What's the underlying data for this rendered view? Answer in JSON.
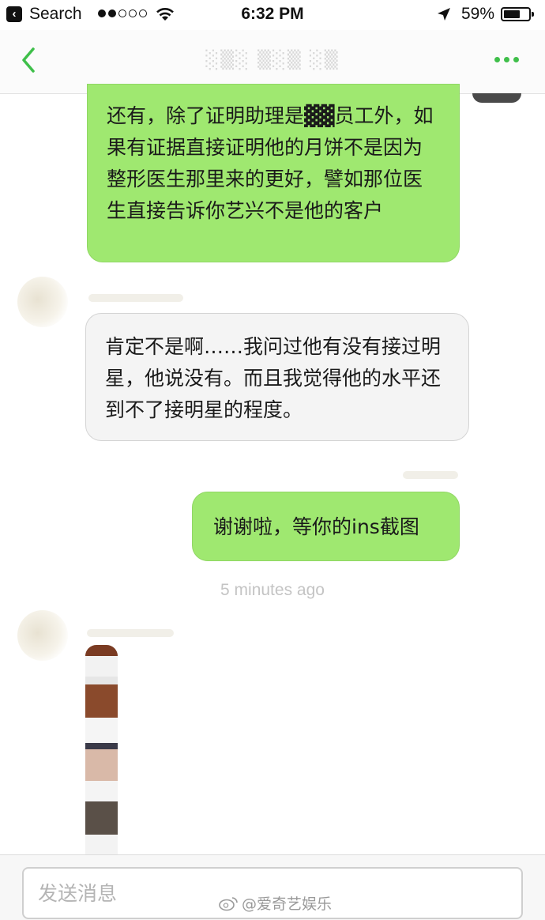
{
  "status_bar": {
    "back_app_label": "Search",
    "signal_bars": [
      true,
      true,
      false,
      false,
      false
    ],
    "time": "6:32 PM",
    "battery_text": "59%",
    "battery_level": 0.59
  },
  "nav": {
    "back_icon": "chevron-left-icon",
    "more_icon": "ellipsis-icon",
    "accent_color": "#3fbf4a"
  },
  "messages": [
    {
      "direction": "outgoing",
      "text": "还有，除了证明助理是▓▓员工外，如果有证据直接证明他的月饼不是因为整形医生那里来的更好，譬如那位医生直接告诉你艺兴不是他的客户"
    },
    {
      "direction": "incoming",
      "text": "肯定不是啊……我问过他有没有接过明星，他说没有。而且我觉得他的水平还到不了接明星的程度。"
    },
    {
      "direction": "outgoing",
      "text": "谢谢啦，等你的ins截图"
    }
  ],
  "timestamp": "5 minutes ago",
  "composer": {
    "placeholder": "发送消息"
  },
  "watermark": "@爱奇艺娱乐",
  "colors": {
    "outgoing_bubble": "#9fe870",
    "incoming_bubble": "#f4f4f4"
  }
}
